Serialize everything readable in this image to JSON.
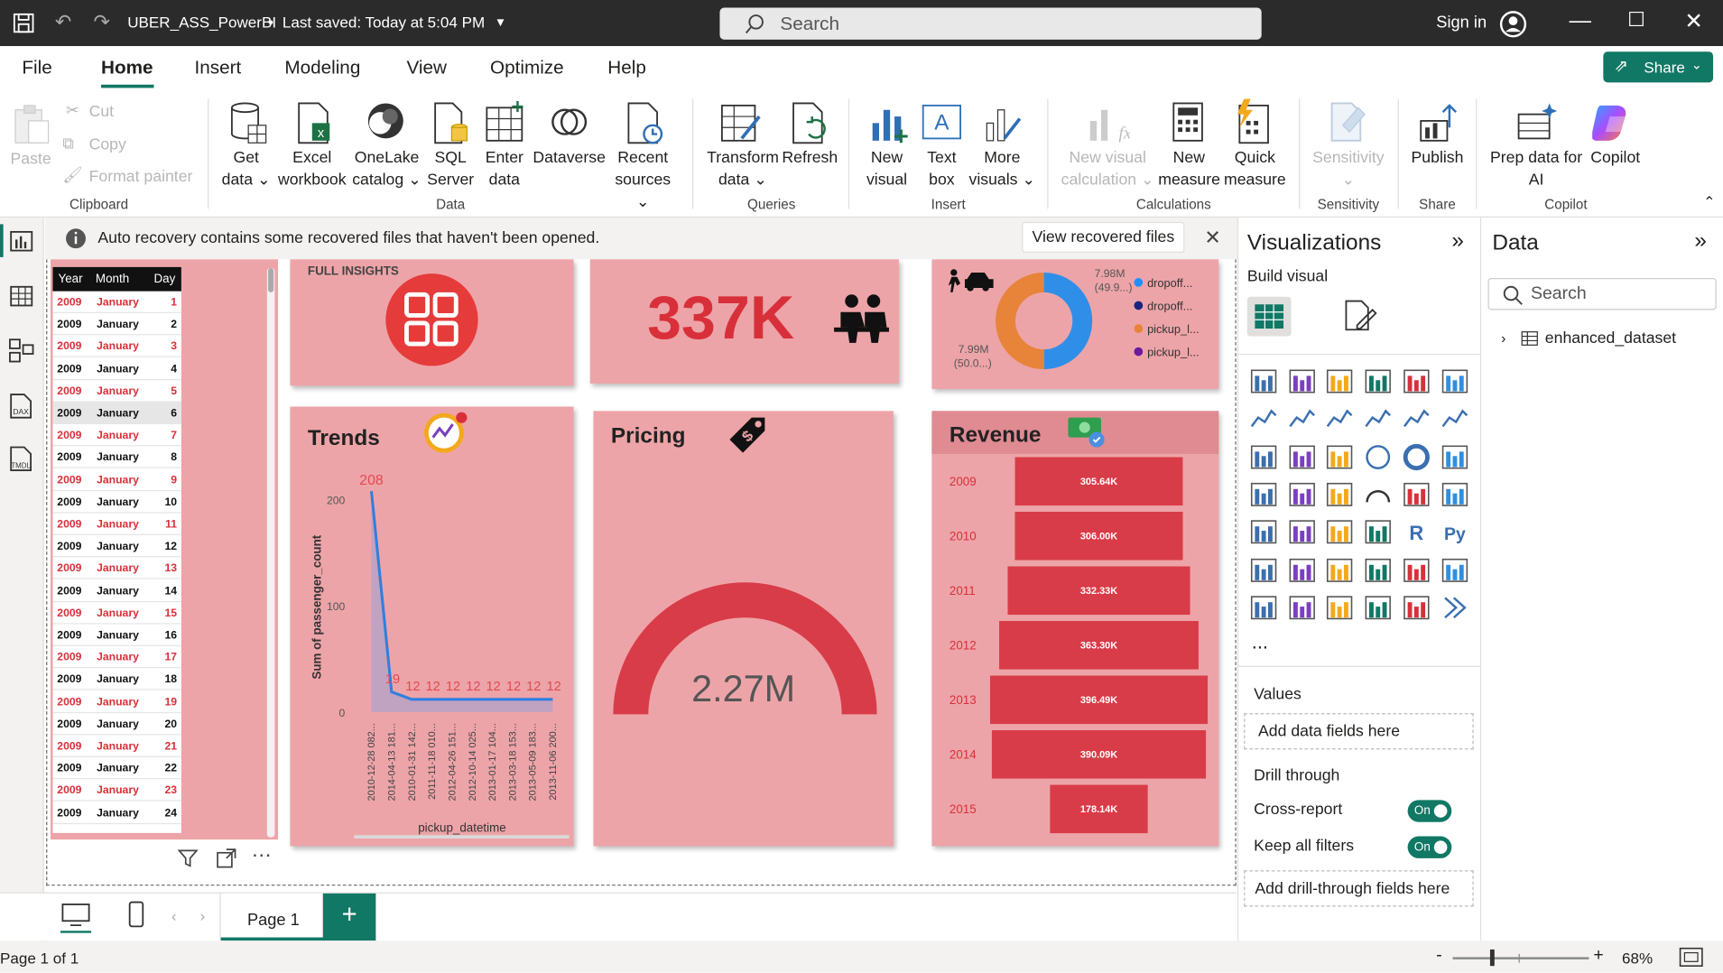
{
  "titlebar": {
    "file": "UBER_ASS_PowerBI",
    "saved": "Last saved: Today at 5:04 PM",
    "search": "Search",
    "signin": "Sign in"
  },
  "menu": {
    "items": [
      "File",
      "Home",
      "Insert",
      "Modeling",
      "View",
      "Optimize",
      "Help"
    ],
    "share": "Share"
  },
  "ribbon": {
    "clipboard": {
      "paste": "Paste",
      "cut": "Cut",
      "copy": "Copy",
      "format_painter": "Format painter",
      "group": "Clipboard"
    },
    "data": {
      "get_data": [
        "Get",
        "data"
      ],
      "excel": [
        "Excel",
        "workbook"
      ],
      "onelake": [
        "OneLake",
        "catalog"
      ],
      "sql": [
        "SQL",
        "Server"
      ],
      "enter": [
        "Enter",
        "data"
      ],
      "dataverse": "Dataverse",
      "recent": [
        "Recent",
        "sources"
      ],
      "group": "Data"
    },
    "queries": {
      "transform": [
        "Transform",
        "data"
      ],
      "refresh": "Refresh",
      "group": "Queries"
    },
    "insert": {
      "new_visual": [
        "New",
        "visual"
      ],
      "text_box": [
        "Text",
        "box"
      ],
      "more_visuals": [
        "More",
        "visuals"
      ],
      "group": "Insert"
    },
    "calculations": {
      "new_visual_calc": [
        "New visual",
        "calculation"
      ],
      "new_measure": [
        "New",
        "measure"
      ],
      "quick_measure": [
        "Quick",
        "measure"
      ],
      "group": "Calculations"
    },
    "sensitivity": {
      "label": "Sensitivity",
      "group": "Sensitivity"
    },
    "share": {
      "publish": "Publish",
      "group": "Share"
    },
    "copilot": {
      "prep": [
        "Prep data for",
        "AI"
      ],
      "copilot": "Copilot",
      "group": "Copilot"
    }
  },
  "notice": {
    "text": "Auto recovery contains some recovered files that haven't been opened.",
    "button": "View recovered files"
  },
  "table": {
    "headers": [
      "Year",
      "Month",
      "Day"
    ],
    "rows": [
      [
        "2009",
        "January",
        "1"
      ],
      [
        "2009",
        "January",
        "2"
      ],
      [
        "2009",
        "January",
        "3"
      ],
      [
        "2009",
        "January",
        "4"
      ],
      [
        "2009",
        "January",
        "5"
      ],
      [
        "2009",
        "January",
        "6"
      ],
      [
        "2009",
        "January",
        "7"
      ],
      [
        "2009",
        "January",
        "8"
      ],
      [
        "2009",
        "January",
        "9"
      ],
      [
        "2009",
        "January",
        "10"
      ],
      [
        "2009",
        "January",
        "11"
      ],
      [
        "2009",
        "January",
        "12"
      ],
      [
        "2009",
        "January",
        "13"
      ],
      [
        "2009",
        "January",
        "14"
      ],
      [
        "2009",
        "January",
        "15"
      ],
      [
        "2009",
        "January",
        "16"
      ],
      [
        "2009",
        "January",
        "17"
      ],
      [
        "2009",
        "January",
        "18"
      ],
      [
        "2009",
        "January",
        "19"
      ],
      [
        "2009",
        "January",
        "20"
      ],
      [
        "2009",
        "January",
        "21"
      ],
      [
        "2009",
        "January",
        "22"
      ],
      [
        "2009",
        "January",
        "23"
      ],
      [
        "2009",
        "January",
        "24"
      ]
    ]
  },
  "cards": {
    "insights": "FULL INSIGHTS",
    "kpi": "337K",
    "trends": "Trends",
    "pricing": "Pricing",
    "pricing_value": "2.27M",
    "revenue": "Revenue"
  },
  "donut": {
    "label_top": [
      "7.98M",
      "(49.9...)"
    ],
    "label_bottom": [
      "7.99M",
      "(50.0...)"
    ],
    "legend": [
      {
        "name": "dropoff...",
        "color": "#1e90ff"
      },
      {
        "name": "dropoff...",
        "color": "#1a237e"
      },
      {
        "name": "pickup_l...",
        "color": "#e8833a"
      },
      {
        "name": "pickup_l...",
        "color": "#6a1b9a"
      }
    ],
    "values": [
      7.98,
      7.99
    ],
    "colors": [
      "#2f8fe8",
      "#e8833a"
    ]
  },
  "chart_data": [
    {
      "type": "line",
      "x": [
        "2010-12-28 082...",
        "2014-04-13 181...",
        "2010-01-31 142...",
        "2011-11-18 010...",
        "2012-04-26 151...",
        "2012-10-14 025...",
        "2013-01-17 104...",
        "2013-03-18 153...",
        "2013-05-09 183...",
        "2013-11-06 200..."
      ],
      "values": [
        208,
        19,
        12,
        12,
        12,
        12,
        12,
        12,
        12,
        12
      ],
      "data_labels": [
        "208",
        "19",
        "12",
        "12",
        "12",
        "12",
        "12",
        "12",
        "12",
        "12"
      ],
      "xlabel": "pickup_datetime",
      "ylabel": "Sum of passenger_count",
      "ylim": [
        0,
        210
      ],
      "yticks": [
        "0",
        "100",
        "200"
      ]
    },
    {
      "type": "bar",
      "categories": [
        "2009",
        "2010",
        "2011",
        "2012",
        "2013",
        "2014",
        "2015"
      ],
      "values": [
        305.64,
        306.0,
        332.33,
        363.3,
        396.49,
        390.09,
        178.14
      ],
      "data_labels": [
        "305.64K",
        "306.00K",
        "332.33K",
        "363.30K",
        "396.49K",
        "390.09K",
        "178.14K"
      ],
      "unit": "K"
    }
  ],
  "viz": {
    "title": "Visualizations",
    "build": "Build visual",
    "values": "Values",
    "add_fields": "Add data fields here",
    "drill": "Drill through",
    "cross": "Cross-report",
    "keep": "Keep all filters",
    "on": "On",
    "drill_add": "Add drill-through fields here",
    "more": "..."
  },
  "data_pane": {
    "title": "Data",
    "search": "Search",
    "dataset": "enhanced_dataset"
  },
  "bottom": {
    "page": "Page 1",
    "status": "Page 1 of 1",
    "zoom": "68%"
  }
}
